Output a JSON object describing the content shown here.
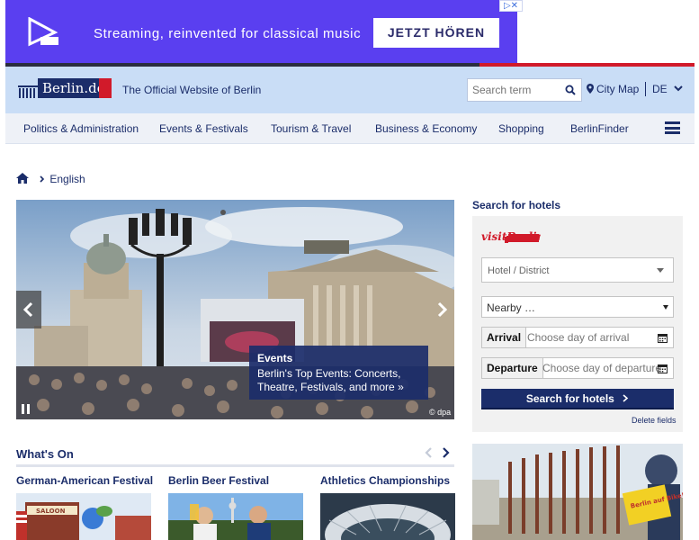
{
  "ad": {
    "text": "Streaming, reinvented for classical music",
    "button": "JETZT HÖREN",
    "close": "▷✕"
  },
  "header": {
    "logo_text": "Berlin.de",
    "tagline": "The Official Website of Berlin",
    "search_placeholder": "Search term",
    "city_map": "City Map",
    "language": "DE"
  },
  "nav": {
    "items": [
      "Politics & Administration",
      "Events & Festivals",
      "Tourism & Travel",
      "Business & Economy",
      "Shopping",
      "BerlinFinder"
    ]
  },
  "breadcrumb": {
    "current": "English"
  },
  "hero": {
    "caption_title": "Events",
    "caption_text": "Berlin's Top Events: Concerts, Theatre, Festivals, and more »",
    "credit": "© dpa"
  },
  "hotel_search": {
    "title": "Search for hotels",
    "district_placeholder": "Hotel / District",
    "nearby": "Nearby …",
    "arrival_label": "Arrival",
    "arrival_placeholder": "Choose day of arrival",
    "departure_label": "Departure",
    "departure_placeholder": "Choose day of departure",
    "button": "Search for hotels",
    "delete": "Delete fields",
    "visit_logo": "visitBerlin"
  },
  "whats_on": {
    "title": "What's On",
    "cards": [
      {
        "title": "German-American Festival"
      },
      {
        "title": "Berlin Beer Festival"
      },
      {
        "title": "Athletics Championships"
      }
    ]
  },
  "colors": {
    "primary": "#1b2d6a",
    "accent_red": "#d11a2a",
    "ad_bg": "#5a3ff0",
    "header_bg": "#c9ddf6"
  }
}
